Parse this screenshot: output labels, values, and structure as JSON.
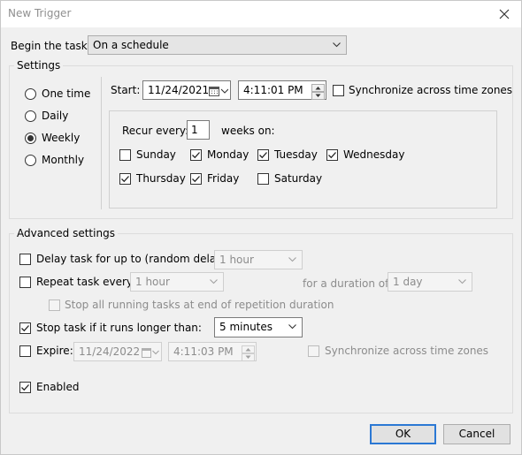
{
  "window": {
    "title": "New Trigger"
  },
  "begin": {
    "label": "Begin the task:",
    "value": "On a schedule"
  },
  "settings": {
    "legend": "Settings",
    "schedule_options": [
      {
        "label": "One time",
        "selected": false
      },
      {
        "label": "Daily",
        "selected": false
      },
      {
        "label": "Weekly",
        "selected": true
      },
      {
        "label": "Monthly",
        "selected": false
      }
    ],
    "start_label": "Start:",
    "start_date": "11/24/2021",
    "start_time": "4:11:01 PM",
    "sync_label": "Synchronize across time zones",
    "sync_checked": false,
    "recur_label": "Recur every:",
    "recur_value": "1",
    "weeks_on_label": "weeks on:",
    "days": [
      {
        "label": "Sunday",
        "checked": false
      },
      {
        "label": "Monday",
        "checked": true
      },
      {
        "label": "Tuesday",
        "checked": true
      },
      {
        "label": "Wednesday",
        "checked": true
      },
      {
        "label": "Thursday",
        "checked": true
      },
      {
        "label": "Friday",
        "checked": true
      },
      {
        "label": "Saturday",
        "checked": false
      }
    ]
  },
  "advanced": {
    "legend": "Advanced settings",
    "delay_label": "Delay task for up to (random delay):",
    "delay_value": "1 hour",
    "repeat_label": "Repeat task every:",
    "repeat_value": "1 hour",
    "duration_label": "for a duration of:",
    "duration_value": "1 day",
    "stop_all_label": "Stop all running tasks at end of repetition duration",
    "stop_label": "Stop task if it runs longer than:",
    "stop_value": "5 minutes",
    "expire_label": "Expire:",
    "expire_date": "11/24/2022",
    "expire_time": "4:11:03 PM",
    "expire_sync_label": "Synchronize across time zones",
    "enabled_label": "Enabled"
  },
  "buttons": {
    "ok": "OK",
    "cancel": "Cancel"
  }
}
